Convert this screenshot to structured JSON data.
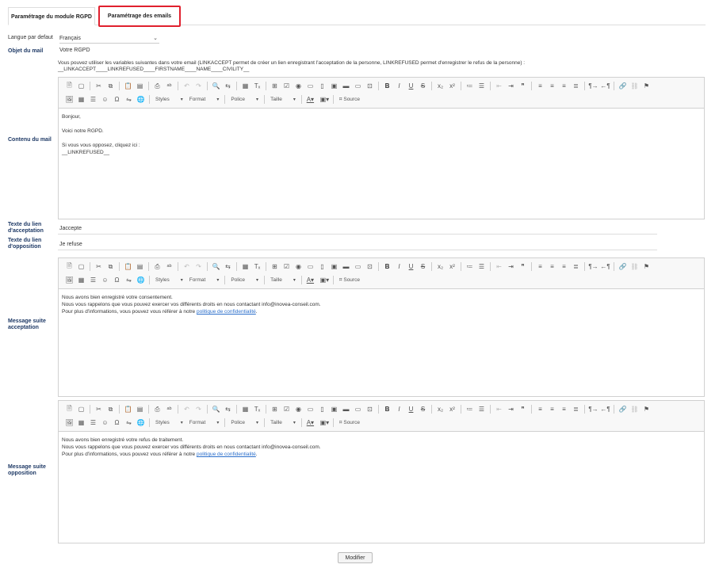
{
  "tabs": [
    {
      "label": "Paramétrage du module RGPD"
    },
    {
      "label": "Paramétrage des emails"
    }
  ],
  "form": {
    "langue_label": "Langue par defaut",
    "langue_value": "Français",
    "objet_label": "Objet du mail",
    "objet_value": "Votre RGPD",
    "help_line1": "Vous pouvez utiliser les variables suivantes dans votre email (LINKACCEPT permet de créer un lien enregistrant l'acceptation de la personne, LINKREFUSED permet d'enregistrer le refus de la personne) :",
    "help_line2": "__LINKACCEPT____LINKREFUSED____FIRSTNAME____NAME____CIVILITY__",
    "contenu_label": "Contenu du mail",
    "texte_accept_label": "Texte du lien d'acceptation",
    "texte_accept_value": "Jaccepte",
    "texte_oppo_label": "Texte du lien d'opposition",
    "texte_oppo_value": "Je refuse",
    "msg_accept_label": "Message suite acceptation",
    "msg_oppo_label": "Message suite opposition",
    "submit_label": "Modifier"
  },
  "toolbar": {
    "styles": "Styles",
    "format": "Format",
    "police": "Police",
    "taille": "Taille",
    "source": "Source"
  },
  "contenu": {
    "l1": "Bonjour,",
    "l2": "Voici notre RGPD.",
    "l3": "Si vous vous opposez, cliquez ici :",
    "l4": "__LINKREFUSED__"
  },
  "accept_msg": {
    "l1": "Nous avons bien enregistré votre consentement.",
    "l2": "Nous vous rappelons que vous pouvez exercer vos différents droits en nous contactant info@inovea-conseil.com.",
    "l3_prefix": "Pour plus d'informations, vous pouvez vous référer à notre ",
    "l3_link": "politique de confidentialité",
    "l3_suffix": "."
  },
  "oppo_msg": {
    "l1": "Nous avons bien enregistré votre refus de traitement.",
    "l2": "Nous vous rappelons que vous pouvez exercer vos différents droits en nous contactant info@inovea-conseil.com.",
    "l3_prefix": "Pour plus d'informations, vous pouvez vous référer à notre ",
    "l3_link": "politique de confidentialité",
    "l3_suffix": "."
  }
}
